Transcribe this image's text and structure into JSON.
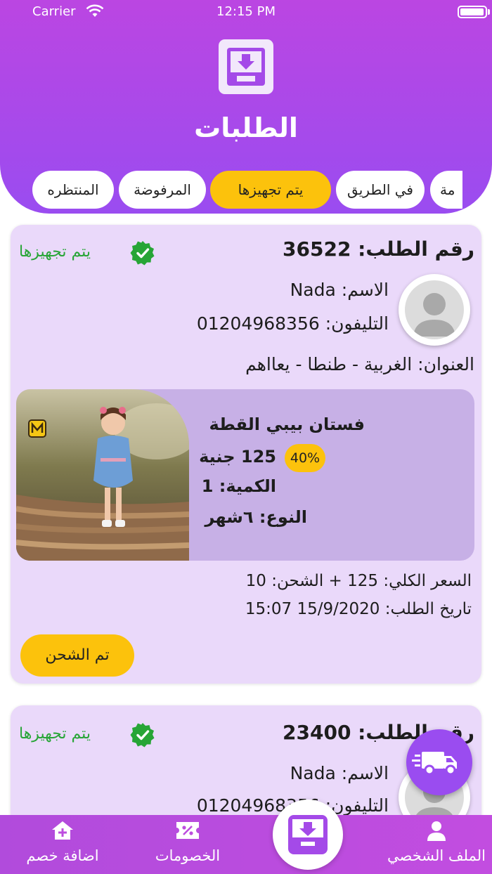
{
  "status_bar": {
    "carrier": "Carrier",
    "time": "12:15 PM"
  },
  "header": {
    "title": "الطلبات",
    "icon": "inbox-download-icon"
  },
  "tabs": [
    {
      "label": "مة",
      "active": false
    },
    {
      "label": "في الطريق",
      "active": false
    },
    {
      "label": "يتم تجهيزها",
      "active": true
    },
    {
      "label": "المرفوضة",
      "active": false
    },
    {
      "label": "المنتظره",
      "active": false
    }
  ],
  "orders": [
    {
      "order_number": "رقم الطلب: 36522",
      "status": "يتم تجهيزها",
      "name": "الاسم: Nada",
      "phone": "التليفون: 01204968356",
      "address": "العنوان: الغربية - طنطا - يعااهم",
      "product": {
        "name": "فستان بيبي القطة",
        "price": "125 جنية",
        "discount": "40%",
        "quantity": "الكمية: 1",
        "type": "النوع: ٦شهر"
      },
      "total": "السعر الكلي: 125 + الشحن: 10",
      "date": "تاريخ الطلب: 15/9/2020 15:07",
      "action_label": "تم الشحن"
    },
    {
      "order_number": "رقم الطلب: 23400",
      "status": "يتم تجهيزها",
      "name": "الاسم: Nada",
      "phone": "التليفون: 01204968356"
    }
  ],
  "bottom_nav": [
    {
      "label": "الملف الشخصي",
      "icon": "person-icon"
    },
    {
      "label": "الخصومات",
      "icon": "discount-ticket-icon"
    },
    {
      "label": "اضافة خصم",
      "icon": "add-home-icon"
    }
  ],
  "colors": {
    "primary": "#9a4cf0",
    "accent": "#fcc20c",
    "success": "#27a536",
    "card": "#ead9fa"
  }
}
